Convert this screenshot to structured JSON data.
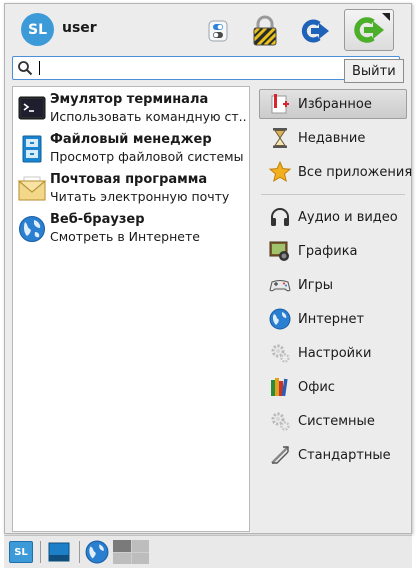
{
  "header": {
    "avatar_text": "SL",
    "username": "user",
    "logout_tooltip": "Выйти"
  },
  "search": {
    "value": "",
    "placeholder": ""
  },
  "favorites": [
    {
      "name": "Эмулятор терминала",
      "description": "Использовать командную ст...",
      "icon": "terminal-icon"
    },
    {
      "name": "Файловый менеджер",
      "description": "Просмотр файловой системы",
      "icon": "file-manager-icon"
    },
    {
      "name": "Почтовая программа",
      "description": "Читать электронную почту",
      "icon": "mail-icon"
    },
    {
      "name": "Веб-браузер",
      "description": "Смотреть в Интернете",
      "icon": "web-browser-icon"
    }
  ],
  "categories": {
    "top": [
      {
        "label": "Избранное",
        "icon": "favorites-icon",
        "selected": true
      },
      {
        "label": "Недавние",
        "icon": "recent-icon"
      },
      {
        "label": "Все приложения",
        "icon": "all-apps-icon"
      }
    ],
    "main": [
      {
        "label": "Аудио и видео",
        "icon": "headphones-icon"
      },
      {
        "label": "Графика",
        "icon": "graphics-icon"
      },
      {
        "label": "Игры",
        "icon": "gamepad-icon"
      },
      {
        "label": "Интернет",
        "icon": "internet-icon"
      },
      {
        "label": "Настройки",
        "icon": "settings-gears-icon"
      },
      {
        "label": "Офис",
        "icon": "office-books-icon"
      },
      {
        "label": "Системные",
        "icon": "system-gears-icon"
      },
      {
        "label": "Стандартные",
        "icon": "accessories-icon"
      }
    ]
  },
  "taskbar": {
    "start_text": "SL"
  },
  "colors": {
    "accent": "#3d9ad8",
    "focus_border": "#4a90d9",
    "logout_green": "#4caf2a",
    "switch_blue": "#1f63b8"
  }
}
